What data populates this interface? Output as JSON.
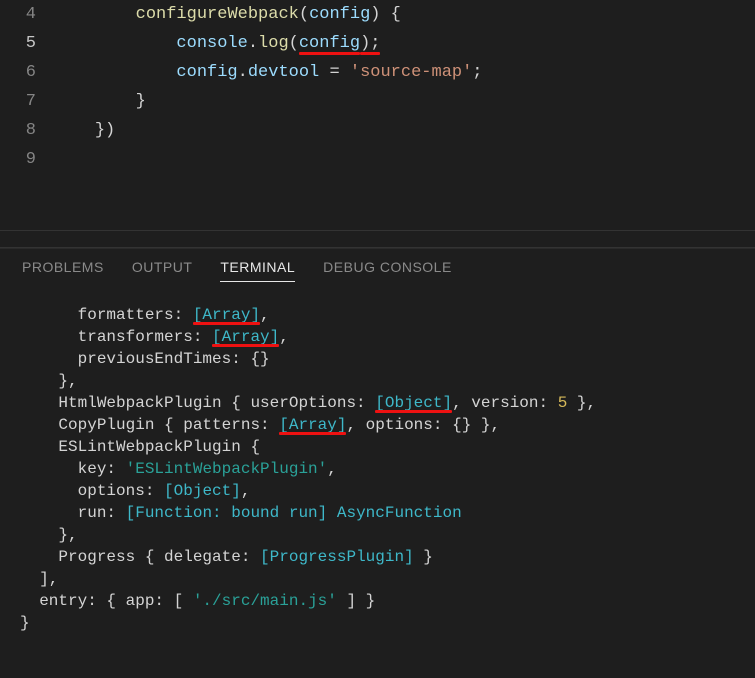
{
  "editor": {
    "lines": [
      {
        "n": 4,
        "indent": "        ",
        "tokens": [
          {
            "t": "configureWebpack",
            "c": "tok-fn"
          },
          {
            "t": "(",
            "c": "tok-punc"
          },
          {
            "t": "config",
            "c": "tok-var"
          },
          {
            "t": ") {",
            "c": "tok-punc"
          }
        ]
      },
      {
        "n": 5,
        "active": true,
        "indent": "            ",
        "tokens": [
          {
            "t": "console",
            "c": "tok-var"
          },
          {
            "t": ".",
            "c": "tok-punc"
          },
          {
            "t": "log",
            "c": "tok-fn"
          },
          {
            "t": "(",
            "c": "tok-punc"
          },
          {
            "t": "config",
            "c": "tok-var",
            "ul": true
          },
          {
            "t": ");",
            "c": "tok-punc",
            "ul": true
          }
        ]
      },
      {
        "n": 6,
        "indent": "            ",
        "tokens": [
          {
            "t": "config",
            "c": "tok-var"
          },
          {
            "t": ".",
            "c": "tok-punc"
          },
          {
            "t": "devtool",
            "c": "tok-prop"
          },
          {
            "t": " = ",
            "c": "tok-punc"
          },
          {
            "t": "'source-map'",
            "c": "tok-str"
          },
          {
            "t": ";",
            "c": "tok-punc"
          }
        ]
      },
      {
        "n": 7,
        "indent": "        ",
        "tokens": [
          {
            "t": "}",
            "c": "tok-punc"
          }
        ]
      },
      {
        "n": 8,
        "indent": "    ",
        "tokens": [
          {
            "t": "})",
            "c": "tok-punc"
          }
        ]
      },
      {
        "n": 9,
        "indent": "",
        "tokens": []
      }
    ]
  },
  "panel": {
    "tabs": [
      "PROBLEMS",
      "OUTPUT",
      "TERMINAL",
      "DEBUG CONSOLE"
    ],
    "active": "TERMINAL"
  },
  "terminal": {
    "lines": [
      [
        {
          "t": "      formatters: "
        },
        {
          "t": "[Array]",
          "c": "t-cyan",
          "ul": true
        },
        {
          "t": ","
        }
      ],
      [
        {
          "t": "      transformers: "
        },
        {
          "t": "[Array]",
          "c": "t-cyan",
          "ul": true
        },
        {
          "t": ","
        }
      ],
      [
        {
          "t": "      previousEndTimes: {}"
        }
      ],
      [
        {
          "t": "    },"
        }
      ],
      [
        {
          "t": "    HtmlWebpackPlugin { userOptions: "
        },
        {
          "t": "[Object]",
          "c": "t-cyan",
          "ul": true
        },
        {
          "t": ", version: "
        },
        {
          "t": "5",
          "c": "t-yellow"
        },
        {
          "t": " },"
        }
      ],
      [
        {
          "t": "    CopyPlugin { patterns: "
        },
        {
          "t": "[Array]",
          "c": "t-cyan",
          "ul": true
        },
        {
          "t": ", options: {} },"
        }
      ],
      [
        {
          "t": "    ESLintWebpackPlugin {"
        }
      ],
      [
        {
          "t": "      key: "
        },
        {
          "t": "'ESLintWebpackPlugin'",
          "c": "t-teal"
        },
        {
          "t": ","
        }
      ],
      [
        {
          "t": "      options: "
        },
        {
          "t": "[Object]",
          "c": "t-cyan"
        },
        {
          "t": ","
        }
      ],
      [
        {
          "t": "      run: "
        },
        {
          "t": "[Function: bound run] AsyncFunction",
          "c": "t-cyan"
        }
      ],
      [
        {
          "t": "    },"
        }
      ],
      [
        {
          "t": "    Progress { delegate: "
        },
        {
          "t": "[ProgressPlugin]",
          "c": "t-cyan"
        },
        {
          "t": " }"
        }
      ],
      [
        {
          "t": "  ],"
        }
      ],
      [
        {
          "t": "  entry: { app: [ "
        },
        {
          "t": "'./src/main.js'",
          "c": "t-teal"
        },
        {
          "t": " ] }"
        }
      ],
      [
        {
          "t": "}"
        }
      ]
    ]
  }
}
